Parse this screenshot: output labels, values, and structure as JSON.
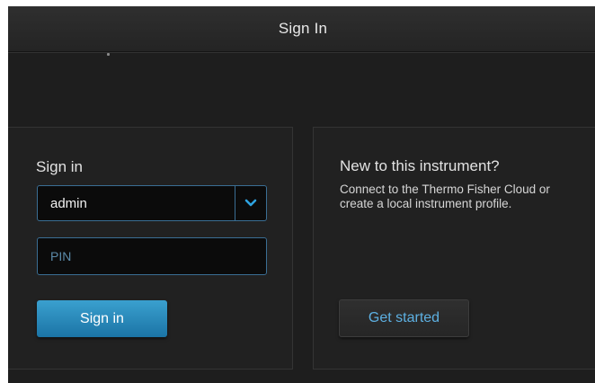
{
  "header": {
    "title": "Sign In"
  },
  "signin_panel": {
    "heading": "Sign in",
    "user_select": {
      "value": "admin"
    },
    "pin_field": {
      "value": "",
      "placeholder": "PIN"
    },
    "signin_button_label": "Sign in"
  },
  "new_panel": {
    "heading": "New to this instrument?",
    "description": "Connect to the Thermo Fisher Cloud or create a local instrument profile.",
    "get_started_label": "Get started"
  },
  "icons": {
    "dropdown": "chevron-down-icon"
  },
  "colors": {
    "background": "#1e1e1e",
    "accent": "#2a8fc4",
    "input_border": "#3a6e94",
    "link_text": "#5db0e2"
  }
}
